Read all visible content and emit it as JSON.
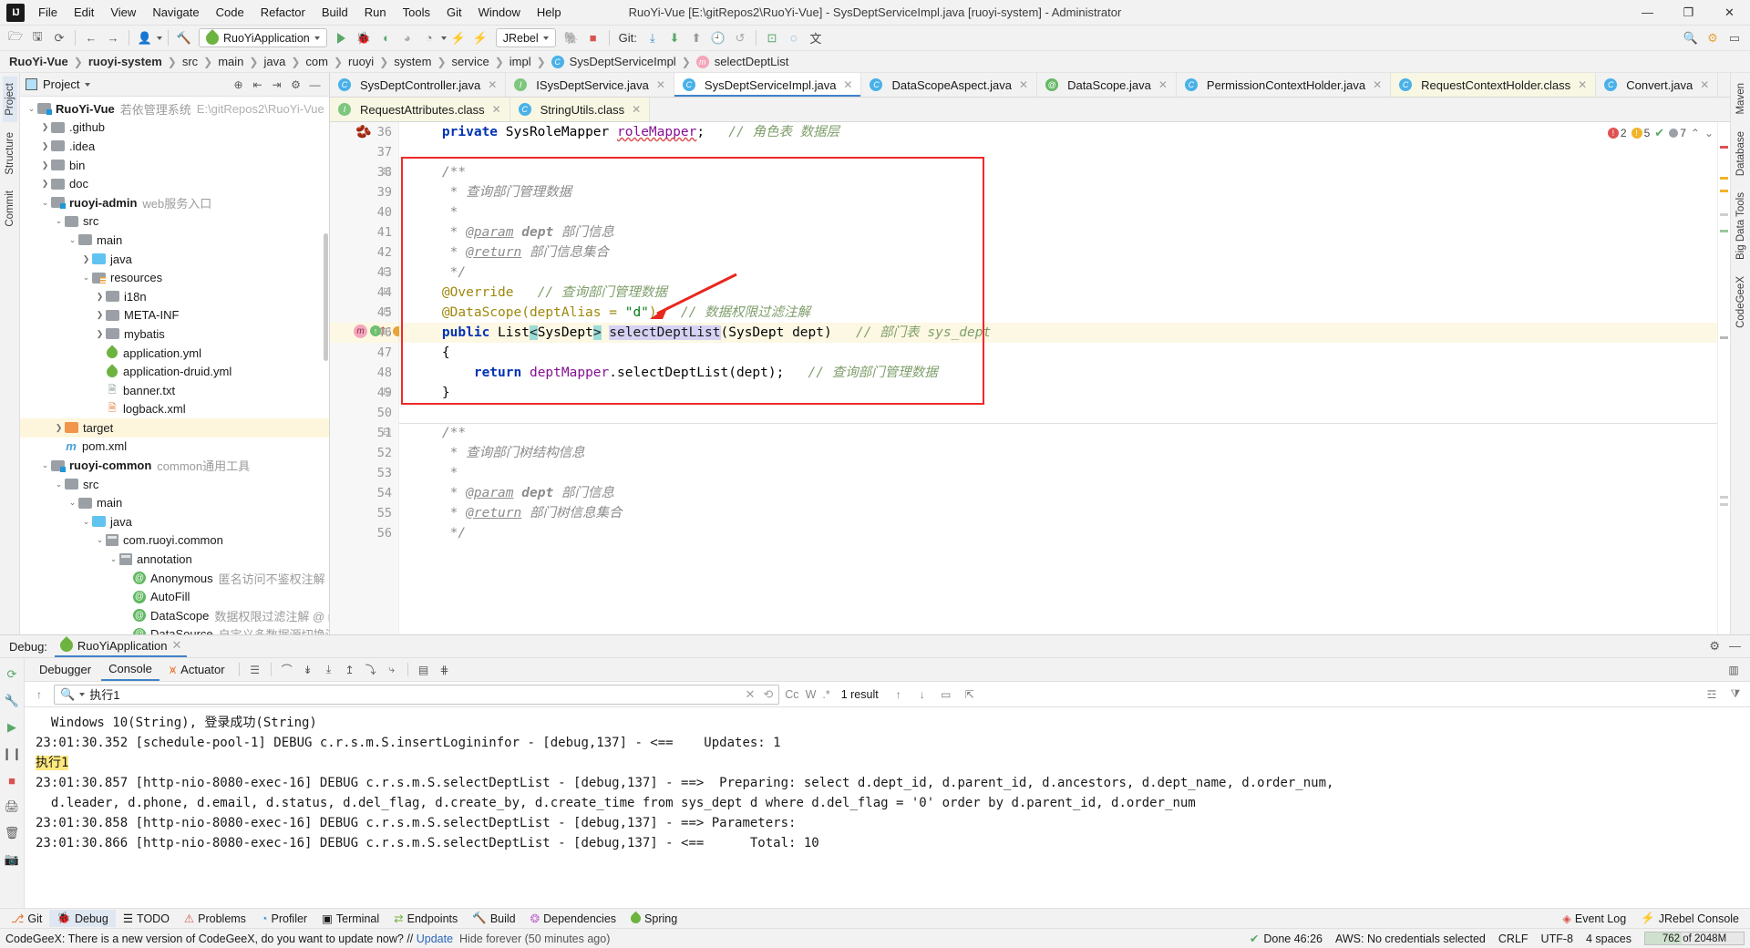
{
  "window": {
    "title": "RuoYi-Vue [E:\\gitRepos2\\RuoYi-Vue] - SysDeptServiceImpl.java [ruoyi-system] - Administrator",
    "minimize": "—",
    "maximize": "❐",
    "close": "✕"
  },
  "menu": [
    "File",
    "Edit",
    "View",
    "Navigate",
    "Code",
    "Refactor",
    "Build",
    "Run",
    "Tools",
    "Git",
    "Window",
    "Help"
  ],
  "toolbar": {
    "run_config": "RuoYiApplication",
    "jrebel": "JRebel",
    "git_label": "Git:"
  },
  "breadcrumb": [
    {
      "label": "RuoYi-Vue",
      "bold": true,
      "chip": null
    },
    {
      "label": "ruoyi-system",
      "bold": true,
      "chip": null
    },
    {
      "label": "src",
      "bold": false,
      "chip": null
    },
    {
      "label": "main",
      "bold": false,
      "chip": null
    },
    {
      "label": "java",
      "bold": false,
      "chip": null
    },
    {
      "label": "com",
      "bold": false,
      "chip": null
    },
    {
      "label": "ruoyi",
      "bold": false,
      "chip": null
    },
    {
      "label": "system",
      "bold": false,
      "chip": null
    },
    {
      "label": "service",
      "bold": false,
      "chip": null
    },
    {
      "label": "impl",
      "bold": false,
      "chip": null
    },
    {
      "label": "SysDeptServiceImpl",
      "bold": false,
      "chip": "C"
    },
    {
      "label": "selectDeptList",
      "bold": false,
      "chip": "m"
    }
  ],
  "left_strips": [
    "Project",
    "Structure",
    "Commit"
  ],
  "right_strips": [
    "Maven",
    "Database",
    "Big Data Tools",
    "CodeGeeX"
  ],
  "project": {
    "title": "Project",
    "tree": [
      {
        "indent": 0,
        "arrow": "down",
        "icon": "module",
        "label": "RuoYi-Vue",
        "bold": true,
        "desc": "若依管理系统",
        "path": "E:\\gitRepos2\\RuoYi-Vue"
      },
      {
        "indent": 1,
        "arrow": "right",
        "icon": "folder",
        "label": ".github",
        "bold": false,
        "desc": "",
        "path": ""
      },
      {
        "indent": 1,
        "arrow": "right",
        "icon": "folder",
        "label": ".idea",
        "bold": false,
        "desc": "",
        "path": ""
      },
      {
        "indent": 1,
        "arrow": "right",
        "icon": "folder",
        "label": "bin",
        "bold": false,
        "desc": "",
        "path": ""
      },
      {
        "indent": 1,
        "arrow": "right",
        "icon": "folder",
        "label": "doc",
        "bold": false,
        "desc": "",
        "path": ""
      },
      {
        "indent": 1,
        "arrow": "down",
        "icon": "module",
        "label": "ruoyi-admin",
        "bold": true,
        "desc": "web服务入口",
        "path": ""
      },
      {
        "indent": 2,
        "arrow": "down",
        "icon": "folder",
        "label": "src",
        "bold": false,
        "desc": "",
        "path": ""
      },
      {
        "indent": 3,
        "arrow": "down",
        "icon": "folder",
        "label": "main",
        "bold": false,
        "desc": "",
        "path": ""
      },
      {
        "indent": 4,
        "arrow": "right",
        "icon": "srcfolder",
        "label": "java",
        "bold": false,
        "desc": "",
        "path": ""
      },
      {
        "indent": 4,
        "arrow": "down",
        "icon": "resfolder",
        "label": "resources",
        "bold": false,
        "desc": "",
        "path": ""
      },
      {
        "indent": 5,
        "arrow": "right",
        "icon": "folder",
        "label": "i18n",
        "bold": false,
        "desc": "",
        "path": ""
      },
      {
        "indent": 5,
        "arrow": "right",
        "icon": "folder",
        "label": "META-INF",
        "bold": false,
        "desc": "",
        "path": ""
      },
      {
        "indent": 5,
        "arrow": "right",
        "icon": "folder",
        "label": "mybatis",
        "bold": false,
        "desc": "",
        "path": ""
      },
      {
        "indent": 5,
        "arrow": "none",
        "icon": "yml",
        "label": "application.yml",
        "bold": false,
        "desc": "",
        "path": ""
      },
      {
        "indent": 5,
        "arrow": "none",
        "icon": "yml",
        "label": "application-druid.yml",
        "bold": false,
        "desc": "",
        "path": ""
      },
      {
        "indent": 5,
        "arrow": "none",
        "icon": "txt",
        "label": "banner.txt",
        "bold": false,
        "desc": "",
        "path": ""
      },
      {
        "indent": 5,
        "arrow": "none",
        "icon": "xml",
        "label": "logback.xml",
        "bold": false,
        "desc": "",
        "path": ""
      },
      {
        "indent": 2,
        "arrow": "right",
        "icon": "target",
        "label": "target",
        "bold": false,
        "desc": "",
        "path": "",
        "highlight": true
      },
      {
        "indent": 2,
        "arrow": "none",
        "icon": "maven",
        "label": "pom.xml",
        "bold": false,
        "desc": "",
        "path": ""
      },
      {
        "indent": 1,
        "arrow": "down",
        "icon": "module",
        "label": "ruoyi-common",
        "bold": true,
        "desc": "common通用工具",
        "path": ""
      },
      {
        "indent": 2,
        "arrow": "down",
        "icon": "folder",
        "label": "src",
        "bold": false,
        "desc": "",
        "path": ""
      },
      {
        "indent": 3,
        "arrow": "down",
        "icon": "folder",
        "label": "main",
        "bold": false,
        "desc": "",
        "path": ""
      },
      {
        "indent": 4,
        "arrow": "down",
        "icon": "srcfolder",
        "label": "java",
        "bold": false,
        "desc": "",
        "path": ""
      },
      {
        "indent": 5,
        "arrow": "down",
        "icon": "package",
        "label": "com.ruoyi.common",
        "bold": false,
        "desc": "",
        "path": ""
      },
      {
        "indent": 6,
        "arrow": "down",
        "icon": "package",
        "label": "annotation",
        "bold": false,
        "desc": "",
        "path": ""
      },
      {
        "indent": 7,
        "arrow": "none",
        "icon": "annotation",
        "label": "Anonymous",
        "bold": false,
        "desc": "匿名访问不鉴权注解 @ ruoyi",
        "path": ""
      },
      {
        "indent": 7,
        "arrow": "none",
        "icon": "annotation",
        "label": "AutoFill",
        "bold": false,
        "desc": "",
        "path": ""
      },
      {
        "indent": 7,
        "arrow": "none",
        "icon": "annotation",
        "label": "DataScope",
        "bold": false,
        "desc": "数据权限过滤注解 @ ruoyi",
        "path": ""
      },
      {
        "indent": 7,
        "arrow": "none",
        "icon": "annotation",
        "label": "DataSource",
        "bold": false,
        "desc": "自定义多数据源切换注解 @ ruoyi",
        "path": ""
      }
    ]
  },
  "editor": {
    "tabs_row1": [
      {
        "label": "SysDeptController.java",
        "chip": "C",
        "active": false,
        "kind": "java"
      },
      {
        "label": "ISysDeptService.java",
        "chip": "I",
        "active": false,
        "kind": "java"
      },
      {
        "label": "SysDeptServiceImpl.java",
        "chip": "C",
        "active": true,
        "kind": "java"
      },
      {
        "label": "DataScopeAspect.java",
        "chip": "C",
        "active": false,
        "kind": "java"
      },
      {
        "label": "DataScope.java",
        "chip": "@",
        "active": false,
        "kind": "java"
      },
      {
        "label": "PermissionContextHolder.java",
        "chip": "C",
        "active": false,
        "kind": "java"
      },
      {
        "label": "RequestContextHolder.class",
        "chip": "C",
        "active": false,
        "kind": "class"
      },
      {
        "label": "Convert.java",
        "chip": "C",
        "active": false,
        "kind": "java"
      }
    ],
    "tabs_row2": [
      {
        "label": "RequestAttributes.class",
        "chip": "I",
        "active": false,
        "kind": "class"
      },
      {
        "label": "StringUtils.class",
        "chip": "C",
        "active": false,
        "kind": "class"
      }
    ],
    "inspections": {
      "errors": "2",
      "warnings": "5",
      "weak": "7"
    },
    "first_line_number": 36,
    "current_line": 46,
    "lines": [
      {
        "n": 36,
        "text": "    private SysRoleMapper roleMapper;   // 角色表 数据层"
      },
      {
        "n": 37,
        "text": ""
      },
      {
        "n": 38,
        "text": "    /**"
      },
      {
        "n": 39,
        "text": "     * 查询部门管理数据"
      },
      {
        "n": 40,
        "text": "     *"
      },
      {
        "n": 41,
        "text": "     * @param dept 部门信息"
      },
      {
        "n": 42,
        "text": "     * @return 部门信息集合"
      },
      {
        "n": 43,
        "text": "     */"
      },
      {
        "n": 44,
        "text": "    @Override   // 查询部门管理数据"
      },
      {
        "n": 45,
        "text": "    @DataScope(deptAlias = \"d\")   // 数据权限过滤注解"
      },
      {
        "n": 46,
        "text": "    public List<SysDept> selectDeptList(SysDept dept)   // 部门表 sys_dept"
      },
      {
        "n": 47,
        "text": "    {"
      },
      {
        "n": 48,
        "text": "        return deptMapper.selectDeptList(dept);   // 查询部门管理数据"
      },
      {
        "n": 49,
        "text": "    }"
      },
      {
        "n": 50,
        "text": ""
      },
      {
        "n": 51,
        "text": "    /**"
      },
      {
        "n": 52,
        "text": "     * 查询部门树结构信息"
      },
      {
        "n": 53,
        "text": "     *"
      },
      {
        "n": 54,
        "text": "     * @param dept 部门信息"
      },
      {
        "n": 55,
        "text": "     * @return 部门树信息集合"
      },
      {
        "n": 56,
        "text": "     */"
      }
    ]
  },
  "debug": {
    "label": "Debug:",
    "session": "RuoYiApplication",
    "tabs": [
      "Debugger",
      "Console",
      "Actuator"
    ],
    "active_tab": "Console",
    "search": {
      "value": "执行1",
      "placeholder": "",
      "result_count": "1 result",
      "match_case": "Cc",
      "words": "W",
      "regex": ".*"
    },
    "console_lines": [
      {
        "text": "  Windows 10(String), 登录成功(String)",
        "highlight": null
      },
      {
        "text": "23:01:30.352 [schedule-pool-1] DEBUG c.r.s.m.S.insertLogininfor - [debug,137] - <==    Updates: 1",
        "highlight": null
      },
      {
        "text": "执行1",
        "highlight": "yellow"
      },
      {
        "text": "23:01:30.857 [http-nio-8080-exec-16] DEBUG c.r.s.m.S.selectDeptList - [debug,137] - ==>  Preparing: select d.dept_id, d.parent_id, d.ancestors, d.dept_name, d.order_num,",
        "highlight": null
      },
      {
        "text": "  d.leader, d.phone, d.email, d.status, d.del_flag, d.create_by, d.create_time from sys_dept d where d.del_flag = '0' order by d.parent_id, d.order_num",
        "highlight": null
      },
      {
        "text": "23:01:30.858 [http-nio-8080-exec-16] DEBUG c.r.s.m.S.selectDeptList - [debug,137] - ==> Parameters:",
        "highlight": null
      },
      {
        "text": "23:01:30.866 [http-nio-8080-exec-16] DEBUG c.r.s.m.S.selectDeptList - [debug,137] - <==      Total: 10",
        "highlight": null
      }
    ]
  },
  "footer": {
    "left": [
      "Git",
      "Debug",
      "TODO",
      "Problems",
      "Profiler",
      "Terminal",
      "Endpoints",
      "Build",
      "Dependencies",
      "Spring"
    ],
    "active": "Debug",
    "right": [
      "Event Log",
      "JRebel Console"
    ]
  },
  "status": {
    "message": "CodeGeeX: There is a new version of CodeGeeX, do you want to update now? // Update  Hide forever (50 minutes ago)",
    "notice_link": "Update",
    "hide_link": "Hide forever (50 minutes ago)",
    "done": "Done  46:26",
    "aws": "AWS: No credentials selected",
    "line_sep": "CRLF",
    "encoding": "UTF-8",
    "indent": "4 spaces",
    "memory": "762 of 2048M"
  }
}
